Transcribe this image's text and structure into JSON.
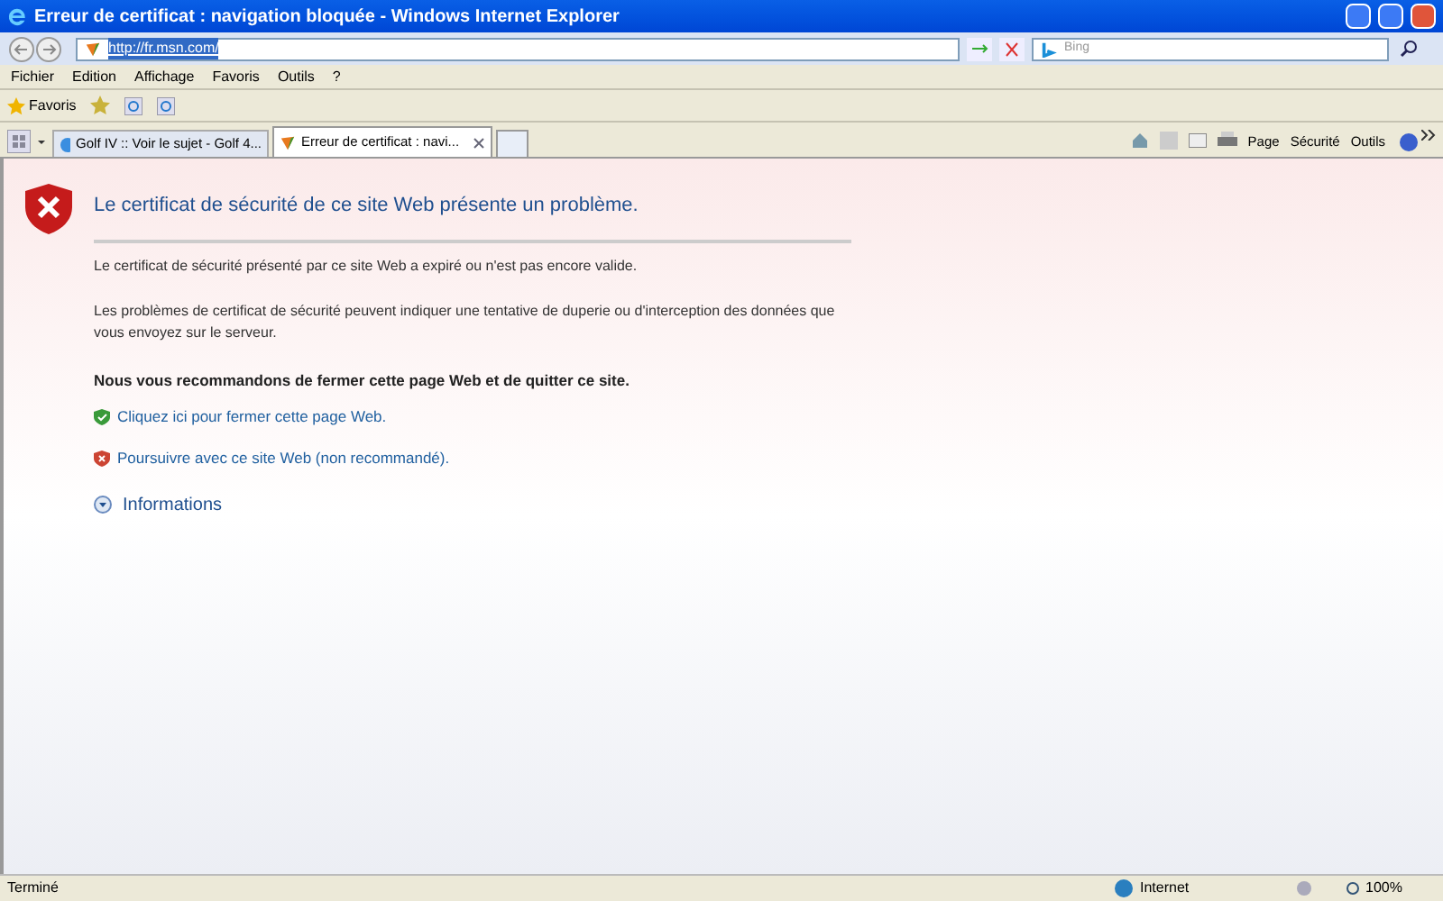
{
  "window": {
    "title": "Erreur de certificat : navigation bloquée - Windows Internet Explorer"
  },
  "address": {
    "url": "http://fr.msn.com/"
  },
  "search": {
    "placeholder": "Bing"
  },
  "menu": [
    "Fichier",
    "Edition",
    "Affichage",
    "Favoris",
    "Outils",
    "?"
  ],
  "favorites": {
    "label": "Favoris"
  },
  "tabs": [
    {
      "label": "Golf IV :: Voir le sujet - Golf 4...",
      "selected": false,
      "kind": "ie"
    },
    {
      "label": "Erreur de certificat : navi...",
      "selected": true,
      "kind": "msn"
    }
  ],
  "command_bar": [
    "Page",
    "Sécurité",
    "Outils"
  ],
  "content": {
    "heading": "Le certificat de sécurité de ce site Web présente un problème.",
    "paragraphs": [
      "Le certificat de sécurité présenté par ce site Web a expiré ou n'est pas encore valide.",
      "Les problèmes de certificat de sécurité peuvent indiquer une tentative de duperie ou d'interception des données que vous envoyez sur le serveur."
    ],
    "recommendation": "Nous vous recommandons de fermer cette page Web et de quitter ce site.",
    "links": [
      {
        "text": "Cliquez ici pour fermer cette page Web.",
        "kind": "safe"
      },
      {
        "text": "Poursuivre avec ce site Web (non recommandé).",
        "kind": "unsafe"
      }
    ],
    "more_info": "Informations"
  },
  "status_bar": {
    "text": "Terminé",
    "zone": "Internet",
    "zoom": "100%"
  }
}
